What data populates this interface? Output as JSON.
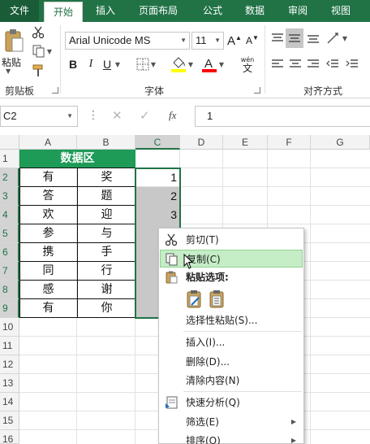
{
  "tabs": [
    "文件",
    "开始",
    "插入",
    "页面布局",
    "公式",
    "数据",
    "审阅",
    "视图"
  ],
  "ribbon": {
    "paste_label": "粘贴",
    "clipboard_group": "剪贴板",
    "font_group": "字体",
    "align_group": "对齐方式",
    "font_name": "Arial Unicode MS",
    "font_size": "11",
    "bold": "B",
    "italic": "I",
    "underline": "U",
    "grow_font": "A",
    "shrink_font": "A",
    "wen_label": "wén",
    "wen_char": "文",
    "font_color_char": "A",
    "fill_color": "#ffff00",
    "font_color": "#ff0000"
  },
  "formula_bar": {
    "name_box": "C2",
    "fx": "fx",
    "value": "1"
  },
  "grid": {
    "columns": [
      "A",
      "B",
      "C",
      "D",
      "E",
      "F",
      "G"
    ],
    "rows": [
      "1",
      "2",
      "3",
      "4",
      "5",
      "6",
      "7",
      "8",
      "9",
      "10",
      "11",
      "12",
      "13",
      "14",
      "15",
      "16"
    ],
    "title": "数据区",
    "col_a": [
      "有",
      "答",
      "欢",
      "参",
      "携",
      "同",
      "感",
      "有"
    ],
    "col_b": [
      "奖",
      "题",
      "迎",
      "与",
      "手",
      "行",
      "谢",
      "你"
    ],
    "col_c_visible": [
      "1",
      "2",
      "3"
    ]
  },
  "context_menu": {
    "cut": "剪切(T)",
    "copy": "复制(C)",
    "paste_options": "粘贴选项:",
    "paste_special": "选择性粘贴(S)...",
    "insert": "插入(I)...",
    "delete": "删除(D)...",
    "clear": "清除内容(N)",
    "quick_analysis": "快速分析(Q)",
    "filter": "筛选(E)",
    "sort": "排序(O)"
  },
  "colors": {
    "accent": "#217346",
    "table_header": "#1e9b57",
    "menu_hover": "#c5edc6"
  }
}
